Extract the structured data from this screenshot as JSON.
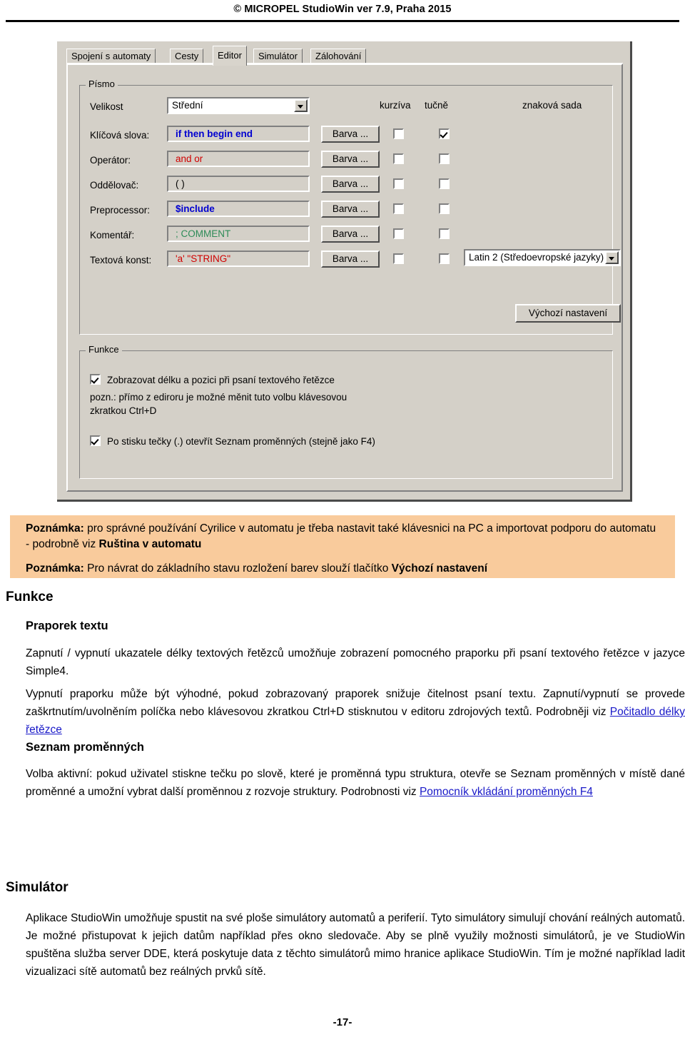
{
  "header": {
    "text": "© MICROPEL StudioWin ver 7.9,  Praha 2015"
  },
  "screenshot": {
    "tabs": [
      {
        "label": "Spojení s automaty",
        "selected": false
      },
      {
        "label": "Cesty",
        "selected": false
      },
      {
        "label": "Editor",
        "selected": true
      },
      {
        "label": "Simulátor",
        "selected": false
      },
      {
        "label": "Zálohování",
        "selected": false
      }
    ],
    "font_group": {
      "legend": "Písmo",
      "size_label": "Velikost",
      "size_value": "Střední",
      "column_headers": {
        "italic": "kurzíva",
        "bold": "tučně",
        "charset": "znaková sada"
      },
      "charset_value": "Latin 2 (Středoevropské jazyky)",
      "color_button_label": "Barva ...",
      "rows": [
        {
          "label": "Klíčová slova:",
          "sample": "if then begin end",
          "color": "#0000d0",
          "italic": false,
          "bold": true
        },
        {
          "label": "Operátor:",
          "sample": "and or",
          "color": "#d00000",
          "italic": false,
          "bold": false
        },
        {
          "label": "Oddělovač:",
          "sample": "( )",
          "color": "#000000",
          "italic": false,
          "bold": false
        },
        {
          "label": "Preprocessor:",
          "sample": "$include",
          "color": "#0000d0",
          "italic": false,
          "bold": false
        },
        {
          "label": "Komentář:",
          "sample": "; COMMENT",
          "color": "#2e8b57",
          "italic": false,
          "bold": false
        },
        {
          "label": "Textová konst:",
          "sample": "'a' \"STRING\"",
          "color": "#d00000",
          "italic": false,
          "bold": false
        }
      ],
      "default_button": "Výchozí nastavení"
    },
    "functions_group": {
      "legend": "Funkce",
      "option1": "Zobrazovat délku a pozici při psaní textového řetězce",
      "option1_checked": true,
      "note_line1": "pozn.: přímo z ediroru je možné měnit tuto volbu klávesovou",
      "note_line2": "zkratkou Ctrl+D",
      "option2": "Po stisku tečky (.) otevřít Seznam proměnných (stejně jako F4)",
      "option2_checked": true
    }
  },
  "notebox": {
    "note1_label": "Poznámka:",
    "note1_text": " pro správné používání Cyrilice v automatu je třeba nastavit také klávesnici na PC a importovat podporu do automatu - podrobně viz ",
    "note1_bold_tail": "Ruština v automatu",
    "note2_label": "Poznámka:",
    "note2_text": " Pro návrat do základního stavu rozložení barev slouží tlačítko ",
    "note2_bold_tail": "Výchozí nastavení"
  },
  "body": {
    "h1_funkce": "Funkce",
    "h2_praporek": "Praporek textu",
    "p_praporek": "Zapnutí / vypnutí ukazatele délky textových řetězců umožňuje zobrazení pomocného praporku při psaní textového řetězce v jazyce Simple4.",
    "p_vypnuti": "Vypnutí praporku může být výhodné, pokud zobrazovaný praporek snižuje čitelnost psaní textu. Zapnutí/vypnutí se provede zaškrtnutím/uvolněním  políčka nebo klávesovou zkratkou Ctrl+D stisknutou v editoru zdrojových textů. Podrobněji viz ",
    "link_pocitadlo": "Počitadlo délky řetězce",
    "h2_seznam": "Seznam proměnných",
    "p_seznam": "Volba aktivní: pokud uživatel stiskne tečku po slově, které je proměnná typu struktura, otevře se Seznam proměnných v místě dané proměnné a umožní vybrat další proměnnou z rozvoje struktury. Podrobnosti viz ",
    "link_pomocnik": "Pomocník vkládání proměnných F4",
    "h1_simulator": "Simulátor",
    "p_simulator": "Aplikace StudioWin umožňuje spustit na své ploše simulátory automatů a periferií. Tyto simulátory simulují chování reálných automatů. Je možné přistupovat k jejich datům například přes okno sledovače. Aby se plně využily možnosti simulátorů, je ve StudioWin spuštěna služba server DDE, která poskytuje data z těchto simulátorů mimo hranice aplikace StudioWin. Tím je možné například ladit vizualizaci sítě automatů bez reálných prvků sítě."
  },
  "footer": {
    "page_number": "-17-"
  }
}
